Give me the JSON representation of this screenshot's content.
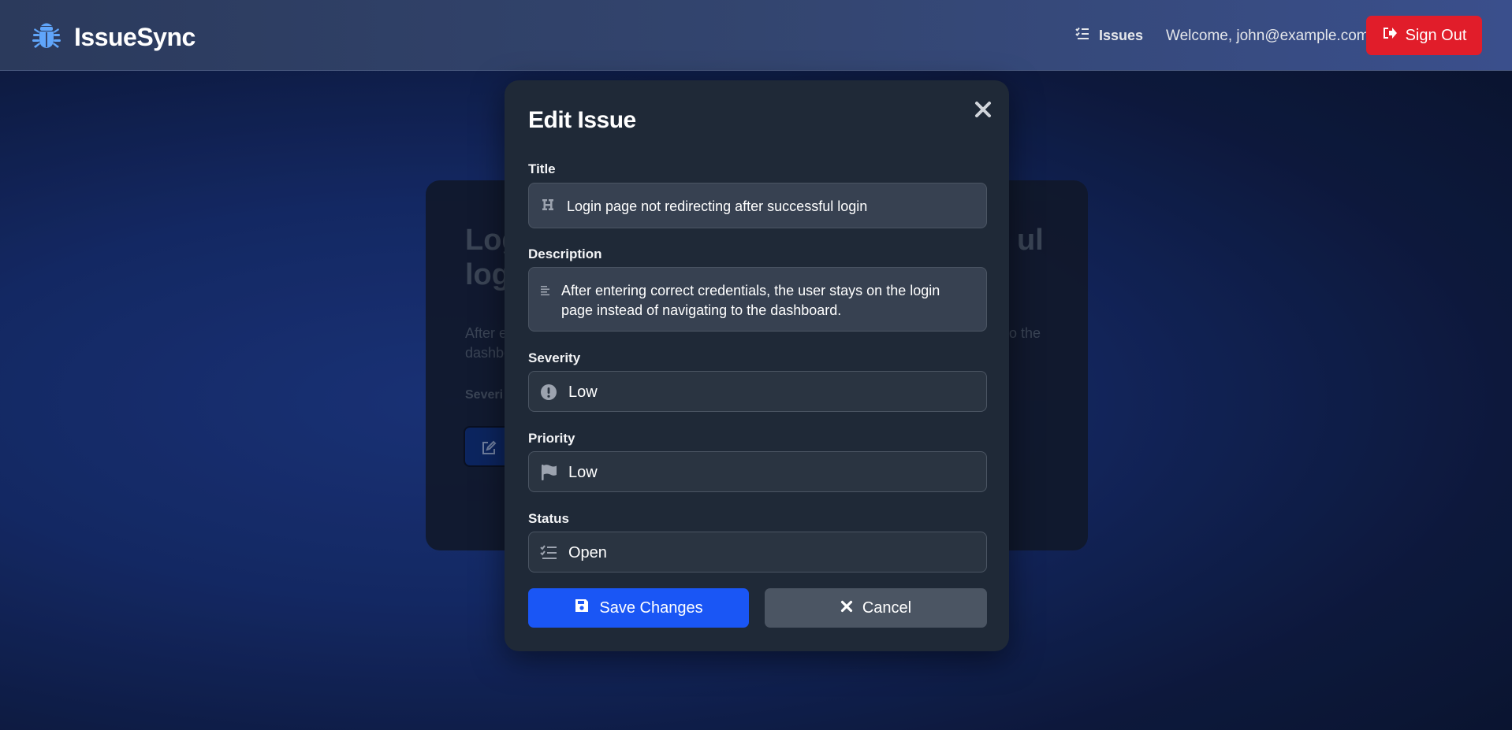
{
  "header": {
    "brand": "IssueSync",
    "nav_issues": "Issues",
    "welcome": "Welcome, john@example.com",
    "sign_out": "Sign Out"
  },
  "background_card": {
    "title_left": "Log",
    "title_right": "ul",
    "title_left_line2": "log",
    "desc_left": "After e",
    "desc_right": "o the",
    "desc_left_line2": "dashbo",
    "severity_left": "Severi"
  },
  "modal": {
    "title": "Edit Issue",
    "fields": {
      "title": {
        "label": "Title",
        "value": "Login page not redirecting after successful login"
      },
      "description": {
        "label": "Description",
        "value": "After entering correct credentials, the user stays on the login page instead of navigating to the dashboard."
      },
      "severity": {
        "label": "Severity",
        "value": "Low"
      },
      "priority": {
        "label": "Priority",
        "value": "Low"
      },
      "status": {
        "label": "Status",
        "value": "Open"
      }
    },
    "save_label": "Save Changes",
    "cancel_label": "Cancel"
  },
  "colors": {
    "accent": "#1a56f5",
    "danger": "#e11d2a",
    "modal_bg": "#1f2937",
    "brand_icon": "#60a5fa"
  },
  "icons": {
    "brand": "bug-icon",
    "issues": "list-check-icon",
    "sign_out": "sign-out-icon",
    "close": "close-icon",
    "title_field": "heading-icon",
    "description_field": "align-left-icon",
    "severity_field": "exclamation-circle-icon",
    "priority_field": "flag-icon",
    "status_field": "list-check-icon",
    "save": "floppy-disk-icon",
    "cancel": "x-icon"
  }
}
